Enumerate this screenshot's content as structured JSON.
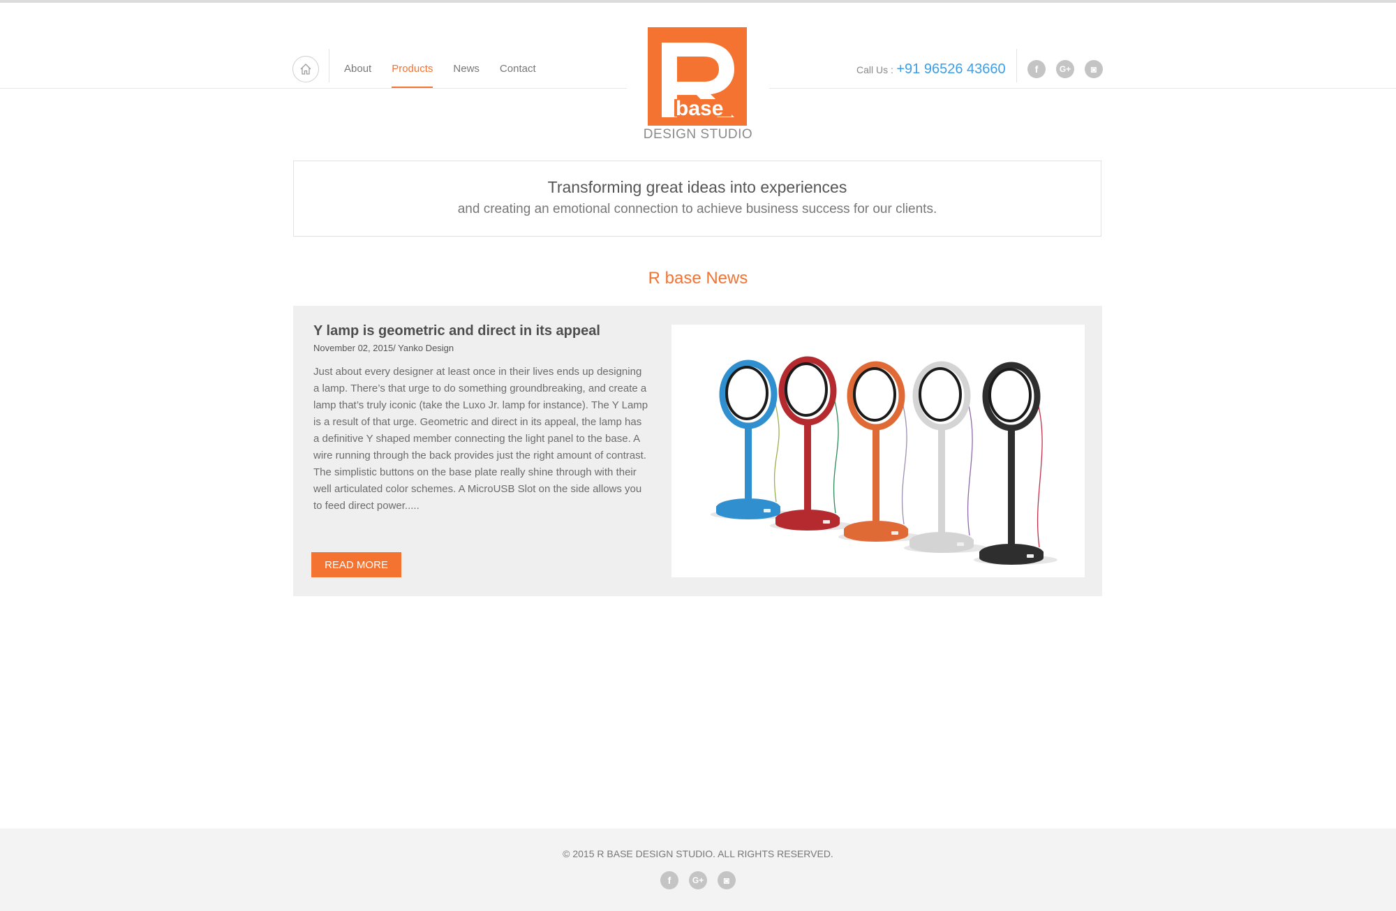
{
  "header": {
    "home_label": "Home",
    "nav": [
      {
        "label": "About",
        "active": false
      },
      {
        "label": "Products",
        "active": true
      },
      {
        "label": "News",
        "active": false
      },
      {
        "label": "Contact",
        "active": false
      }
    ],
    "logo": {
      "letter": "R",
      "word": "base",
      "caption": "DESIGN STUDIO"
    },
    "call_label": "Call Us :",
    "phone": "+91 96526 43660",
    "social": [
      {
        "icon": "facebook-icon",
        "glyph": "f"
      },
      {
        "icon": "google-plus-icon",
        "glyph": "G+"
      },
      {
        "icon": "instagram-icon",
        "glyph": "◙"
      }
    ]
  },
  "tagline": {
    "headline": "Transforming great ideas into experiences",
    "subline": "and creating an emotional connection to achieve business success for our clients."
  },
  "news_section": {
    "title": "R base News",
    "article": {
      "title": "Y lamp is geometric and direct in its appeal",
      "meta": "November 02, 2015/ Yanko Design",
      "body": "Just about every designer at least once in their lives ends up designing a lamp. There’s that urge to do something groundbreaking, and create a lamp that’s truly iconic (take the Luxo Jr. lamp for instance). The Y Lamp is a result of that urge. Geometric and direct in its appeal, the lamp has a definitive Y shaped member connecting the light panel to the base. A wire running through the back provides just the right amount of contrast. The simplistic buttons on the base plate really shine through with their well articulated color schemes. A MicroUSB Slot on the side allows you to feed direct power.....",
      "read_more": "READ MORE",
      "lamp_colors": [
        "#2f8fcf",
        "#b42a2e",
        "#e06a35",
        "#d4d4d4",
        "#2e2e2e"
      ]
    }
  },
  "footer": {
    "copyright": "© 2015 R BASE DESIGN STUDIO. ALL RIGHTS RESERVED."
  },
  "colors": {
    "accent": "#f47330",
    "phone": "#3b9ee6",
    "card_bg": "#efefef",
    "footer_bg": "#f3f3f3"
  }
}
